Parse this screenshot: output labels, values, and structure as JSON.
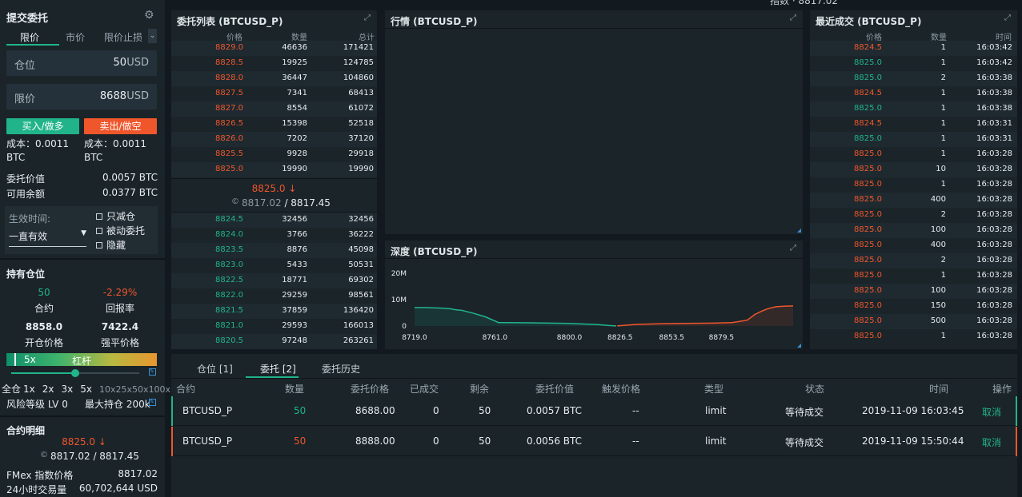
{
  "top_partial": "指数 · 8817.02",
  "submit": {
    "title": "提交委托",
    "tabs": [
      "限价",
      "市价",
      "限价止损"
    ],
    "position_label": "仓位",
    "position_value": "50",
    "position_unit": "USD",
    "limit_label": "限价",
    "limit_value": "8688",
    "limit_unit": "USD",
    "buy_label": "买入/做多",
    "sell_label": "卖出/做空",
    "cost_buy": "成本：0.0011",
    "cost_buy_unit": "BTC",
    "cost_sell": "成本：0.0011",
    "cost_sell_unit": "BTC",
    "order_value_label": "委托价值",
    "order_value": "0.0057 BTC",
    "balance_label": "可用余额",
    "balance": "0.0377 BTC",
    "effective_label": "生效时间:",
    "effective_value": "一直有效",
    "checks": [
      "只减仓",
      "被动委托",
      "隐藏"
    ]
  },
  "position": {
    "title": "持有仓位",
    "contracts": "50",
    "contracts_label": "合约",
    "pnl": "-2.29%",
    "pnl_label": "回报率",
    "open_price": "8858.0",
    "open_label": "开仓价格",
    "liq_price": "7422.4",
    "liq_label": "强平价格",
    "leverage_value": "5x",
    "leverage_label": "杠杆",
    "leverage_level": 0.5,
    "leverage_opts": [
      "全仓",
      "1x",
      "2x",
      "3x",
      "5x",
      "10x",
      "25x",
      "50x",
      "100x"
    ],
    "risk_label": "风险等级 LV 0",
    "max_label": "最大持仓 200k"
  },
  "contract": {
    "title": "合约明细",
    "last": "8825.0 ↓",
    "index_line": "8817.02 / 8817.45",
    "fmex_label": "FMex 指数价格",
    "fmex_value": "8817.02",
    "vol_label": "24小时交易量",
    "vol_value": "60,702,644 USD"
  },
  "orderbook": {
    "title": "委托列表 (BTCUSD_P)",
    "headers": [
      "价格",
      "数量",
      "总计"
    ],
    "asks": [
      [
        "8829.0",
        "46636",
        "171421"
      ],
      [
        "8828.5",
        "19925",
        "124785"
      ],
      [
        "8828.0",
        "36447",
        "104860"
      ],
      [
        "8827.5",
        "7341",
        "68413"
      ],
      [
        "8827.0",
        "8554",
        "61072"
      ],
      [
        "8826.5",
        "15398",
        "52518"
      ],
      [
        "8826.0",
        "7202",
        "37120"
      ],
      [
        "8825.5",
        "9928",
        "29918"
      ],
      [
        "8825.0",
        "19990",
        "19990"
      ]
    ],
    "mid_price": "8825.0 ↓",
    "mid_index": "8817.02",
    "mid_mark": "8817.45",
    "bids": [
      [
        "8824.5",
        "32456",
        "32456"
      ],
      [
        "8824.0",
        "3766",
        "36222"
      ],
      [
        "8823.5",
        "8876",
        "45098"
      ],
      [
        "8823.0",
        "5433",
        "50531"
      ],
      [
        "8822.5",
        "18771",
        "69302"
      ],
      [
        "8822.0",
        "29259",
        "98561"
      ],
      [
        "8821.5",
        "37859",
        "136420"
      ],
      [
        "8821.0",
        "29593",
        "166013"
      ],
      [
        "8820.5",
        "97248",
        "263261"
      ]
    ]
  },
  "market": {
    "title": "行情 (BTCUSD_P)"
  },
  "depth": {
    "title": "深度 (BTCUSD_P)"
  },
  "chart_data": {
    "type": "area",
    "title": "深度 (BTCUSD_P)",
    "y_ticks": [
      "20M",
      "10M",
      "0"
    ],
    "x_ticks": [
      "8719.0",
      "8761.0",
      "8800.0",
      "8826.5",
      "8853.5",
      "8879.5"
    ],
    "ylim": [
      0,
      20000000
    ],
    "xlim": [
      8719,
      8917
    ],
    "series": [
      {
        "color": "#21b48a",
        "x": [
          8719,
          8724,
          8733,
          8738,
          8740,
          8744,
          8746,
          8750,
          8756,
          8763,
          8780,
          8800,
          8810,
          8815,
          8820,
          8824.5
        ],
        "values": [
          7000000,
          7000000,
          6800000,
          6500000,
          6200000,
          5900000,
          5500000,
          4800000,
          3500000,
          1300000,
          1200000,
          1000000,
          700000,
          500000,
          200000,
          30000
        ]
      },
      {
        "color": "#f0562c",
        "x": [
          8825,
          8835,
          8850,
          8860,
          8875,
          8885,
          8893,
          8897,
          8901,
          8904,
          8908,
          8912,
          8917
        ],
        "values": [
          20000,
          600000,
          900000,
          1000000,
          1100000,
          1300000,
          2200000,
          4400000,
          5800000,
          6600000,
          7300000,
          7500000,
          7600000
        ]
      }
    ]
  },
  "trades": {
    "title": "最近成交 (BTCUSD_P)",
    "headers": [
      "价格",
      "数量",
      "时间"
    ],
    "rows": [
      [
        "8824.5",
        "1",
        "16:03:42",
        "s"
      ],
      [
        "8825.0",
        "1",
        "16:03:42",
        "b"
      ],
      [
        "8825.0",
        "2",
        "16:03:38",
        "b"
      ],
      [
        "8824.5",
        "1",
        "16:03:38",
        "s"
      ],
      [
        "8825.0",
        "1",
        "16:03:38",
        "b"
      ],
      [
        "8824.5",
        "1",
        "16:03:31",
        "s"
      ],
      [
        "8825.0",
        "1",
        "16:03:31",
        "b"
      ],
      [
        "8825.0",
        "1",
        "16:03:28",
        "s"
      ],
      [
        "8825.0",
        "10",
        "16:03:28",
        "s"
      ],
      [
        "8825.0",
        "1",
        "16:03:28",
        "s"
      ],
      [
        "8825.0",
        "400",
        "16:03:28",
        "s"
      ],
      [
        "8825.0",
        "2",
        "16:03:28",
        "s"
      ],
      [
        "8825.0",
        "100",
        "16:03:28",
        "s"
      ],
      [
        "8825.0",
        "400",
        "16:03:28",
        "s"
      ],
      [
        "8825.0",
        "2",
        "16:03:28",
        "s"
      ],
      [
        "8825.0",
        "1",
        "16:03:28",
        "s"
      ],
      [
        "8825.0",
        "100",
        "16:03:28",
        "s"
      ],
      [
        "8825.0",
        "150",
        "16:03:28",
        "s"
      ],
      [
        "8825.0",
        "500",
        "16:03:28",
        "s"
      ],
      [
        "8825.0",
        "1",
        "16:03:28",
        "s"
      ]
    ]
  },
  "orders": {
    "tabs": [
      "仓位 [1]",
      "委托 [2]",
      "委托历史"
    ],
    "headers": [
      "合约",
      "数量",
      "委托价格",
      "已成交",
      "剩余",
      "委托价值",
      "触发价格",
      "类型",
      "状态",
      "时间",
      "操作"
    ],
    "rows": [
      {
        "contract": "BTCUSD_P",
        "qty": "50",
        "price": "8688.00",
        "filled": "0",
        "remain": "50",
        "value": "0.0057 BTC",
        "trigger": "--",
        "type": "limit",
        "status": "等待成交",
        "time": "2019-11-09 16:03:45",
        "action": "取消",
        "side": "b"
      },
      {
        "contract": "BTCUSD_P",
        "qty": "50",
        "price": "8888.00",
        "filled": "0",
        "remain": "50",
        "value": "0.0056 BTC",
        "trigger": "--",
        "type": "limit",
        "status": "等待成交",
        "time": "2019-11-09 15:50:44",
        "action": "取消",
        "side": "s"
      }
    ]
  },
  "colors": {
    "buy": "#21b48a",
    "sell": "#f0562c",
    "panel": "#1a2429",
    "bg": "#131a1f"
  }
}
